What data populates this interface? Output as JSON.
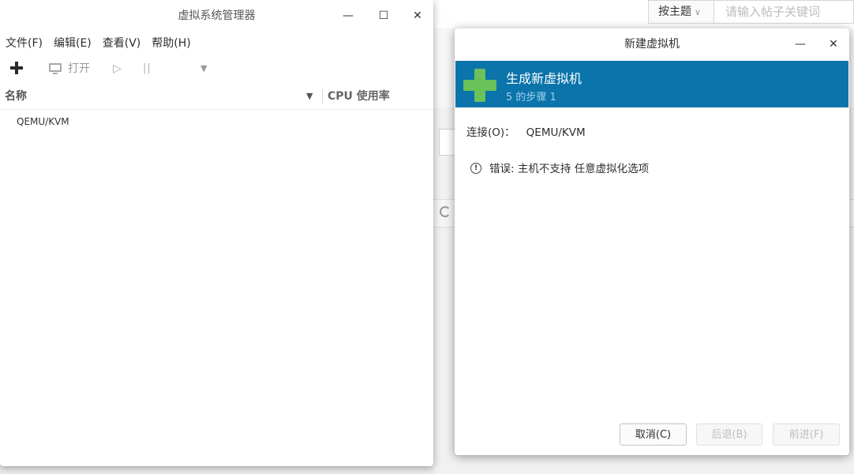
{
  "background_page": {
    "search_select": "按主题",
    "search_placeholder": "请输入帖子关键词"
  },
  "manager_window": {
    "title": "虚拟系统管理器",
    "controls": {
      "minimize": "—",
      "maximize": "☐",
      "close": "✕"
    },
    "menu": [
      "文件(F)",
      "编辑(E)",
      "查看(V)",
      "帮助(H)"
    ],
    "toolbar": {
      "open_label": "打开"
    },
    "columns": {
      "name": "名称",
      "cpu": "CPU 使用率"
    },
    "rows": [
      {
        "name": "QEMU/KVM"
      }
    ]
  },
  "new_vm_dialog": {
    "title": "新建虚拟机",
    "controls": {
      "minimize": "—",
      "close": "✕"
    },
    "banner_title": "生成新虚拟机",
    "banner_step": "5 的步骤 1",
    "connection_label": "连接(O)：",
    "connection_value": "QEMU/KVM",
    "error_icon": "!",
    "error_text": "错误: 主机不支持 任意虚拟化选项",
    "buttons": {
      "cancel": "取消(C)",
      "back": "后退(B)",
      "forward": "前进(F)"
    }
  },
  "colors": {
    "banner": "#0b74aa",
    "plus": "#6ac259"
  }
}
